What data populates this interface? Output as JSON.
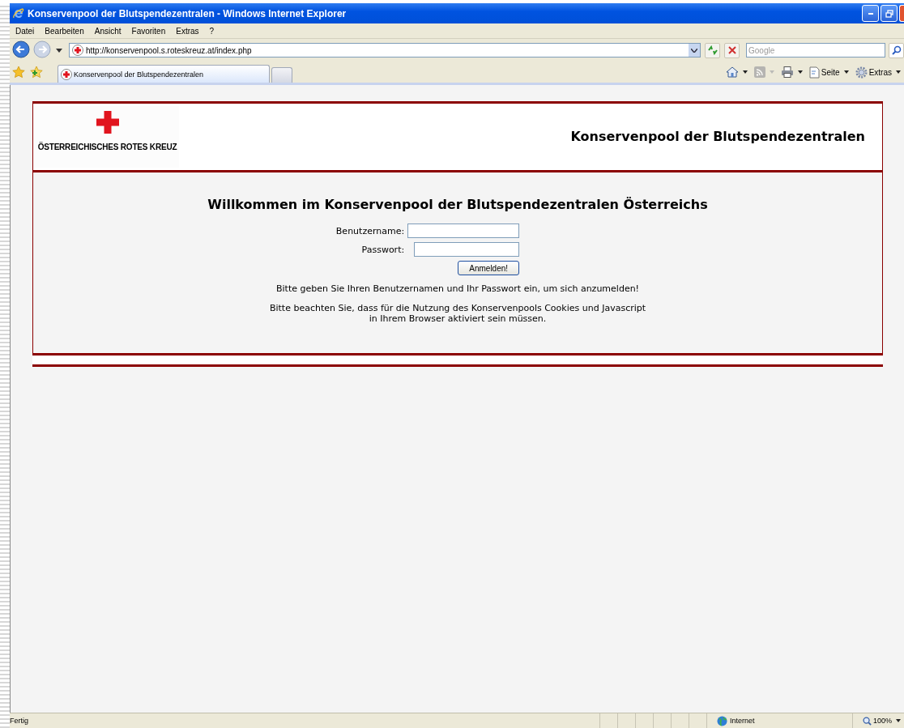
{
  "window": {
    "title": "Konservenpool der Blutspendezentralen - Windows Internet Explorer"
  },
  "menu": [
    "Datei",
    "Bearbeiten",
    "Ansicht",
    "Favoriten",
    "Extras",
    "?"
  ],
  "address": {
    "value": "http://konservenpool.s.roteskreuz.at/index.php"
  },
  "search": {
    "placeholder": "Google"
  },
  "tabs": [
    {
      "label": "Konservenpool der Blutspendezentralen",
      "selected": true
    }
  ],
  "command_bar": [
    {
      "kind": "home"
    },
    {
      "kind": "feed",
      "disabled": true
    },
    {
      "kind": "print"
    },
    {
      "kind": "page",
      "label": "Seite"
    },
    {
      "kind": "tools",
      "label": "Extras"
    }
  ],
  "page": {
    "logo_text": "ÖSTERREICHISCHES ROTES KREUZ",
    "header_title": "Konservenpool der Blutspendezentralen",
    "heading": "Willkommen im Konservenpool der Blutspendezentralen Österreichs",
    "fields": [
      {
        "label": "Benutzername:"
      },
      {
        "label": "Passwort:"
      }
    ],
    "button": "Anmelden!",
    "notes": [
      "Bitte geben Sie Ihren Benutzernamen und Ihr Passwort ein, um sich anzumelden!",
      "Bitte beachten Sie, dass für die Nutzung des Konservenpools Cookies und Javascript",
      "in Ihrem Browser aktiviert sein müssen."
    ]
  },
  "status_bar": {
    "text": "Fertig",
    "zone": "Internet",
    "zoom": "100%"
  }
}
